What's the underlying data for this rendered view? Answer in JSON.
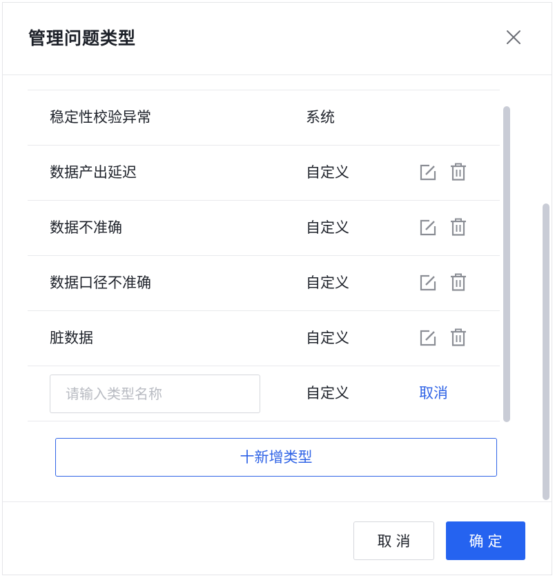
{
  "dialog": {
    "title": "管理问题类型",
    "close_icon": "close-icon"
  },
  "rows": [
    {
      "name": "稳定性校验异常",
      "kind": "系统",
      "editable": false
    },
    {
      "name": "数据产出延迟",
      "kind": "自定义",
      "editable": true
    },
    {
      "name": "数据不准确",
      "kind": "自定义",
      "editable": true
    },
    {
      "name": "数据口径不准确",
      "kind": "自定义",
      "editable": true
    },
    {
      "name": "脏数据",
      "kind": "自定义",
      "editable": true
    }
  ],
  "new_row": {
    "input_value": "",
    "input_placeholder": "请输入类型名称",
    "kind": "自定义",
    "cancel_label": "取消"
  },
  "add_button_label": "十新增类型",
  "footer": {
    "cancel_label": "取消",
    "ok_label": "确定"
  },
  "icons": {
    "edit": "edit-icon",
    "delete": "trash-icon"
  },
  "colors": {
    "accent": "#2563f0",
    "link": "#2f63e6",
    "text": "#1d2129",
    "icon": "#8a8d94",
    "scrollbar": "#c9ccd6"
  }
}
